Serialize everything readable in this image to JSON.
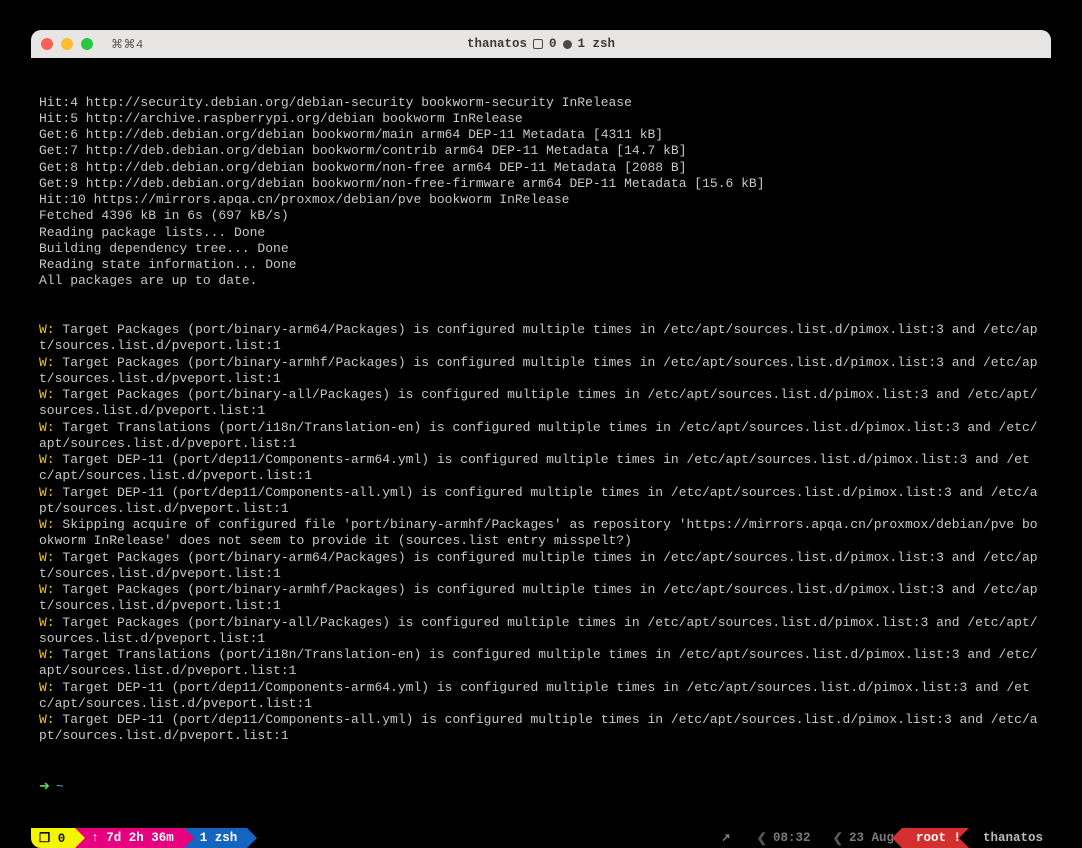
{
  "titlebar": {
    "left_hint": "⌘⌘4",
    "host": "thanatos",
    "tab_info_left": "0",
    "tab_info_right": "1 zsh"
  },
  "output": {
    "plain": [
      "Hit:4 http://security.debian.org/debian-security bookworm-security InRelease",
      "Hit:5 http://archive.raspberrypi.org/debian bookworm InRelease",
      "Get:6 http://deb.debian.org/debian bookworm/main arm64 DEP-11 Metadata [4311 kB]",
      "Get:7 http://deb.debian.org/debian bookworm/contrib arm64 DEP-11 Metadata [14.7 kB]",
      "Get:8 http://deb.debian.org/debian bookworm/non-free arm64 DEP-11 Metadata [2088 B]",
      "Get:9 http://deb.debian.org/debian bookworm/non-free-firmware arm64 DEP-11 Metadata [15.6 kB]",
      "Hit:10 https://mirrors.apqa.cn/proxmox/debian/pve bookworm InRelease",
      "Fetched 4396 kB in 6s (697 kB/s)",
      "Reading package lists... Done",
      "Building dependency tree... Done",
      "Reading state information... Done",
      "All packages are up to date."
    ],
    "warnings": [
      "Target Packages (port/binary-arm64/Packages) is configured multiple times in /etc/apt/sources.list.d/pimox.list:3 and /etc/apt/sources.list.d/pveport.list:1",
      "Target Packages (port/binary-armhf/Packages) is configured multiple times in /etc/apt/sources.list.d/pimox.list:3 and /etc/apt/sources.list.d/pveport.list:1",
      "Target Packages (port/binary-all/Packages) is configured multiple times in /etc/apt/sources.list.d/pimox.list:3 and /etc/apt/sources.list.d/pveport.list:1",
      "Target Translations (port/i18n/Translation-en) is configured multiple times in /etc/apt/sources.list.d/pimox.list:3 and /etc/apt/sources.list.d/pveport.list:1",
      "Target DEP-11 (port/dep11/Components-arm64.yml) is configured multiple times in /etc/apt/sources.list.d/pimox.list:3 and /etc/apt/sources.list.d/pveport.list:1",
      "Target DEP-11 (port/dep11/Components-all.yml) is configured multiple times in /etc/apt/sources.list.d/pimox.list:3 and /etc/apt/sources.list.d/pveport.list:1",
      "Skipping acquire of configured file 'port/binary-armhf/Packages' as repository 'https://mirrors.apqa.cn/proxmox/debian/pve bookworm InRelease' does not seem to provide it (sources.list entry misspelt?)",
      "Target Packages (port/binary-arm64/Packages) is configured multiple times in /etc/apt/sources.list.d/pimox.list:3 and /etc/apt/sources.list.d/pveport.list:1",
      "Target Packages (port/binary-armhf/Packages) is configured multiple times in /etc/apt/sources.list.d/pimox.list:3 and /etc/apt/sources.list.d/pveport.list:1",
      "Target Packages (port/binary-all/Packages) is configured multiple times in /etc/apt/sources.list.d/pimox.list:3 and /etc/apt/sources.list.d/pveport.list:1",
      "Target Translations (port/i18n/Translation-en) is configured multiple times in /etc/apt/sources.list.d/pimox.list:3 and /etc/apt/sources.list.d/pveport.list:1",
      "Target DEP-11 (port/dep11/Components-arm64.yml) is configured multiple times in /etc/apt/sources.list.d/pimox.list:3 and /etc/apt/sources.list.d/pveport.list:1",
      "Target DEP-11 (port/dep11/Components-all.yml) is configured multiple times in /etc/apt/sources.list.d/pimox.list:3 and /etc/apt/sources.list.d/pveport.list:1"
    ],
    "warn_prefix": "W:"
  },
  "prompt": {
    "arrow": "➜",
    "cwd": "~"
  },
  "status": {
    "session": "❐ 0",
    "uptime": "↑ 7d 2h 36m",
    "window": "1 zsh",
    "time": "08:32",
    "date": "23 Aug",
    "user": "root !",
    "host": "thanatos"
  }
}
